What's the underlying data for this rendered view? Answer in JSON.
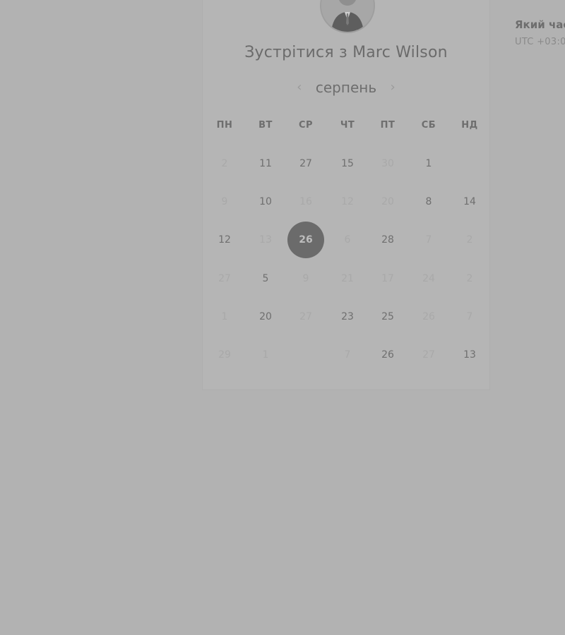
{
  "booking": {
    "title": "Зустрітися з Marc Wilson",
    "avatar_icon": "person-avatar",
    "month": "серпень",
    "prev_icon": "chevron-left-icon",
    "next_icon": "chevron-right-icon",
    "weekdays": [
      "ПН",
      "ВТ",
      "СР",
      "ЧТ",
      "ПТ",
      "СБ",
      "НД"
    ],
    "weeks": [
      [
        {
          "t": "2",
          "off": true
        },
        {
          "t": "11",
          "off": false
        },
        {
          "t": "27",
          "off": false
        },
        {
          "t": "15",
          "off": false
        },
        {
          "t": "30",
          "off": true
        },
        {
          "t": "1",
          "off": false
        },
        {
          "t": "",
          "off": true
        }
      ],
      [
        {
          "t": "9",
          "off": true
        },
        {
          "t": "10",
          "off": false
        },
        {
          "t": "16",
          "off": true
        },
        {
          "t": "12",
          "off": true
        },
        {
          "t": "20",
          "off": true
        },
        {
          "t": "8",
          "off": false
        },
        {
          "t": "14",
          "off": false
        }
      ],
      [
        {
          "t": "12",
          "off": false
        },
        {
          "t": "13",
          "off": true
        },
        {
          "t": "26",
          "off": false,
          "selected": true
        },
        {
          "t": "6",
          "off": true
        },
        {
          "t": "28",
          "off": false
        },
        {
          "t": "7",
          "off": true
        },
        {
          "t": "2",
          "off": true
        }
      ],
      [
        {
          "t": "27",
          "off": true
        },
        {
          "t": "5",
          "off": false
        },
        {
          "t": "9",
          "off": true
        },
        {
          "t": "21",
          "off": true
        },
        {
          "t": "17",
          "off": true
        },
        {
          "t": "24",
          "off": true
        },
        {
          "t": "2",
          "off": true
        }
      ],
      [
        {
          "t": "1",
          "off": true
        },
        {
          "t": "20",
          "off": false
        },
        {
          "t": "27",
          "off": true
        },
        {
          "t": "23",
          "off": false
        },
        {
          "t": "25",
          "off": false
        },
        {
          "t": "26",
          "off": true
        },
        {
          "t": "7",
          "off": true
        }
      ],
      [
        {
          "t": "29",
          "off": true
        },
        {
          "t": "1",
          "off": true
        },
        {
          "t": "",
          "off": true
        },
        {
          "t": "7",
          "off": true
        },
        {
          "t": "26",
          "off": false
        },
        {
          "t": "27",
          "off": true
        },
        {
          "t": "13",
          "off": false
        }
      ]
    ]
  },
  "time_panel": {
    "heading": "Який час",
    "timezone": "UTC +03:0"
  }
}
